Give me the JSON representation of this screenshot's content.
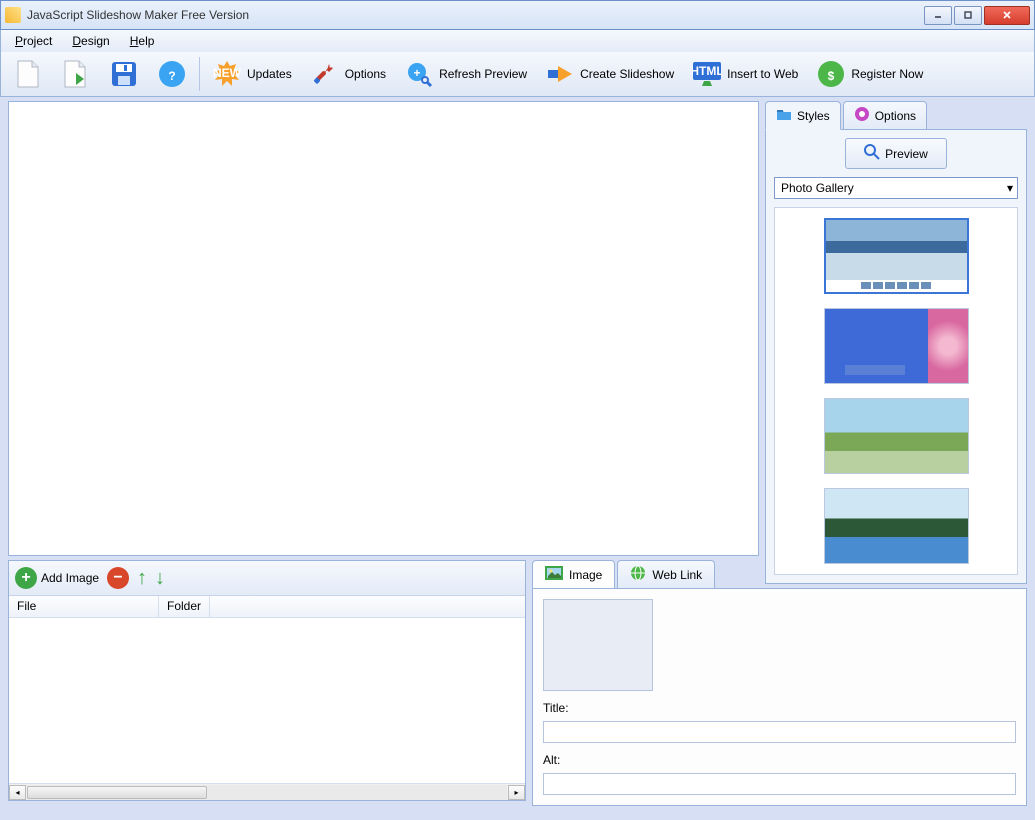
{
  "window": {
    "title": "JavaScript Slideshow Maker Free Version"
  },
  "menu": {
    "project": "Project",
    "design": "Design",
    "help": "Help"
  },
  "toolbar": {
    "updates": "Updates",
    "options": "Options",
    "refresh": "Refresh Preview",
    "create": "Create Slideshow",
    "insert": "Insert to Web",
    "register": "Register Now"
  },
  "right": {
    "tab_styles": "Styles",
    "tab_options": "Options",
    "preview_btn": "Preview",
    "dropdown": "Photo Gallery"
  },
  "bottom_left": {
    "add_image": "Add Image",
    "col_file": "File",
    "col_folder": "Folder"
  },
  "bottom_right": {
    "tab_image": "Image",
    "tab_weblink": "Web Link",
    "title_label": "Title:",
    "alt_label": "Alt:",
    "title_value": "",
    "alt_value": ""
  }
}
